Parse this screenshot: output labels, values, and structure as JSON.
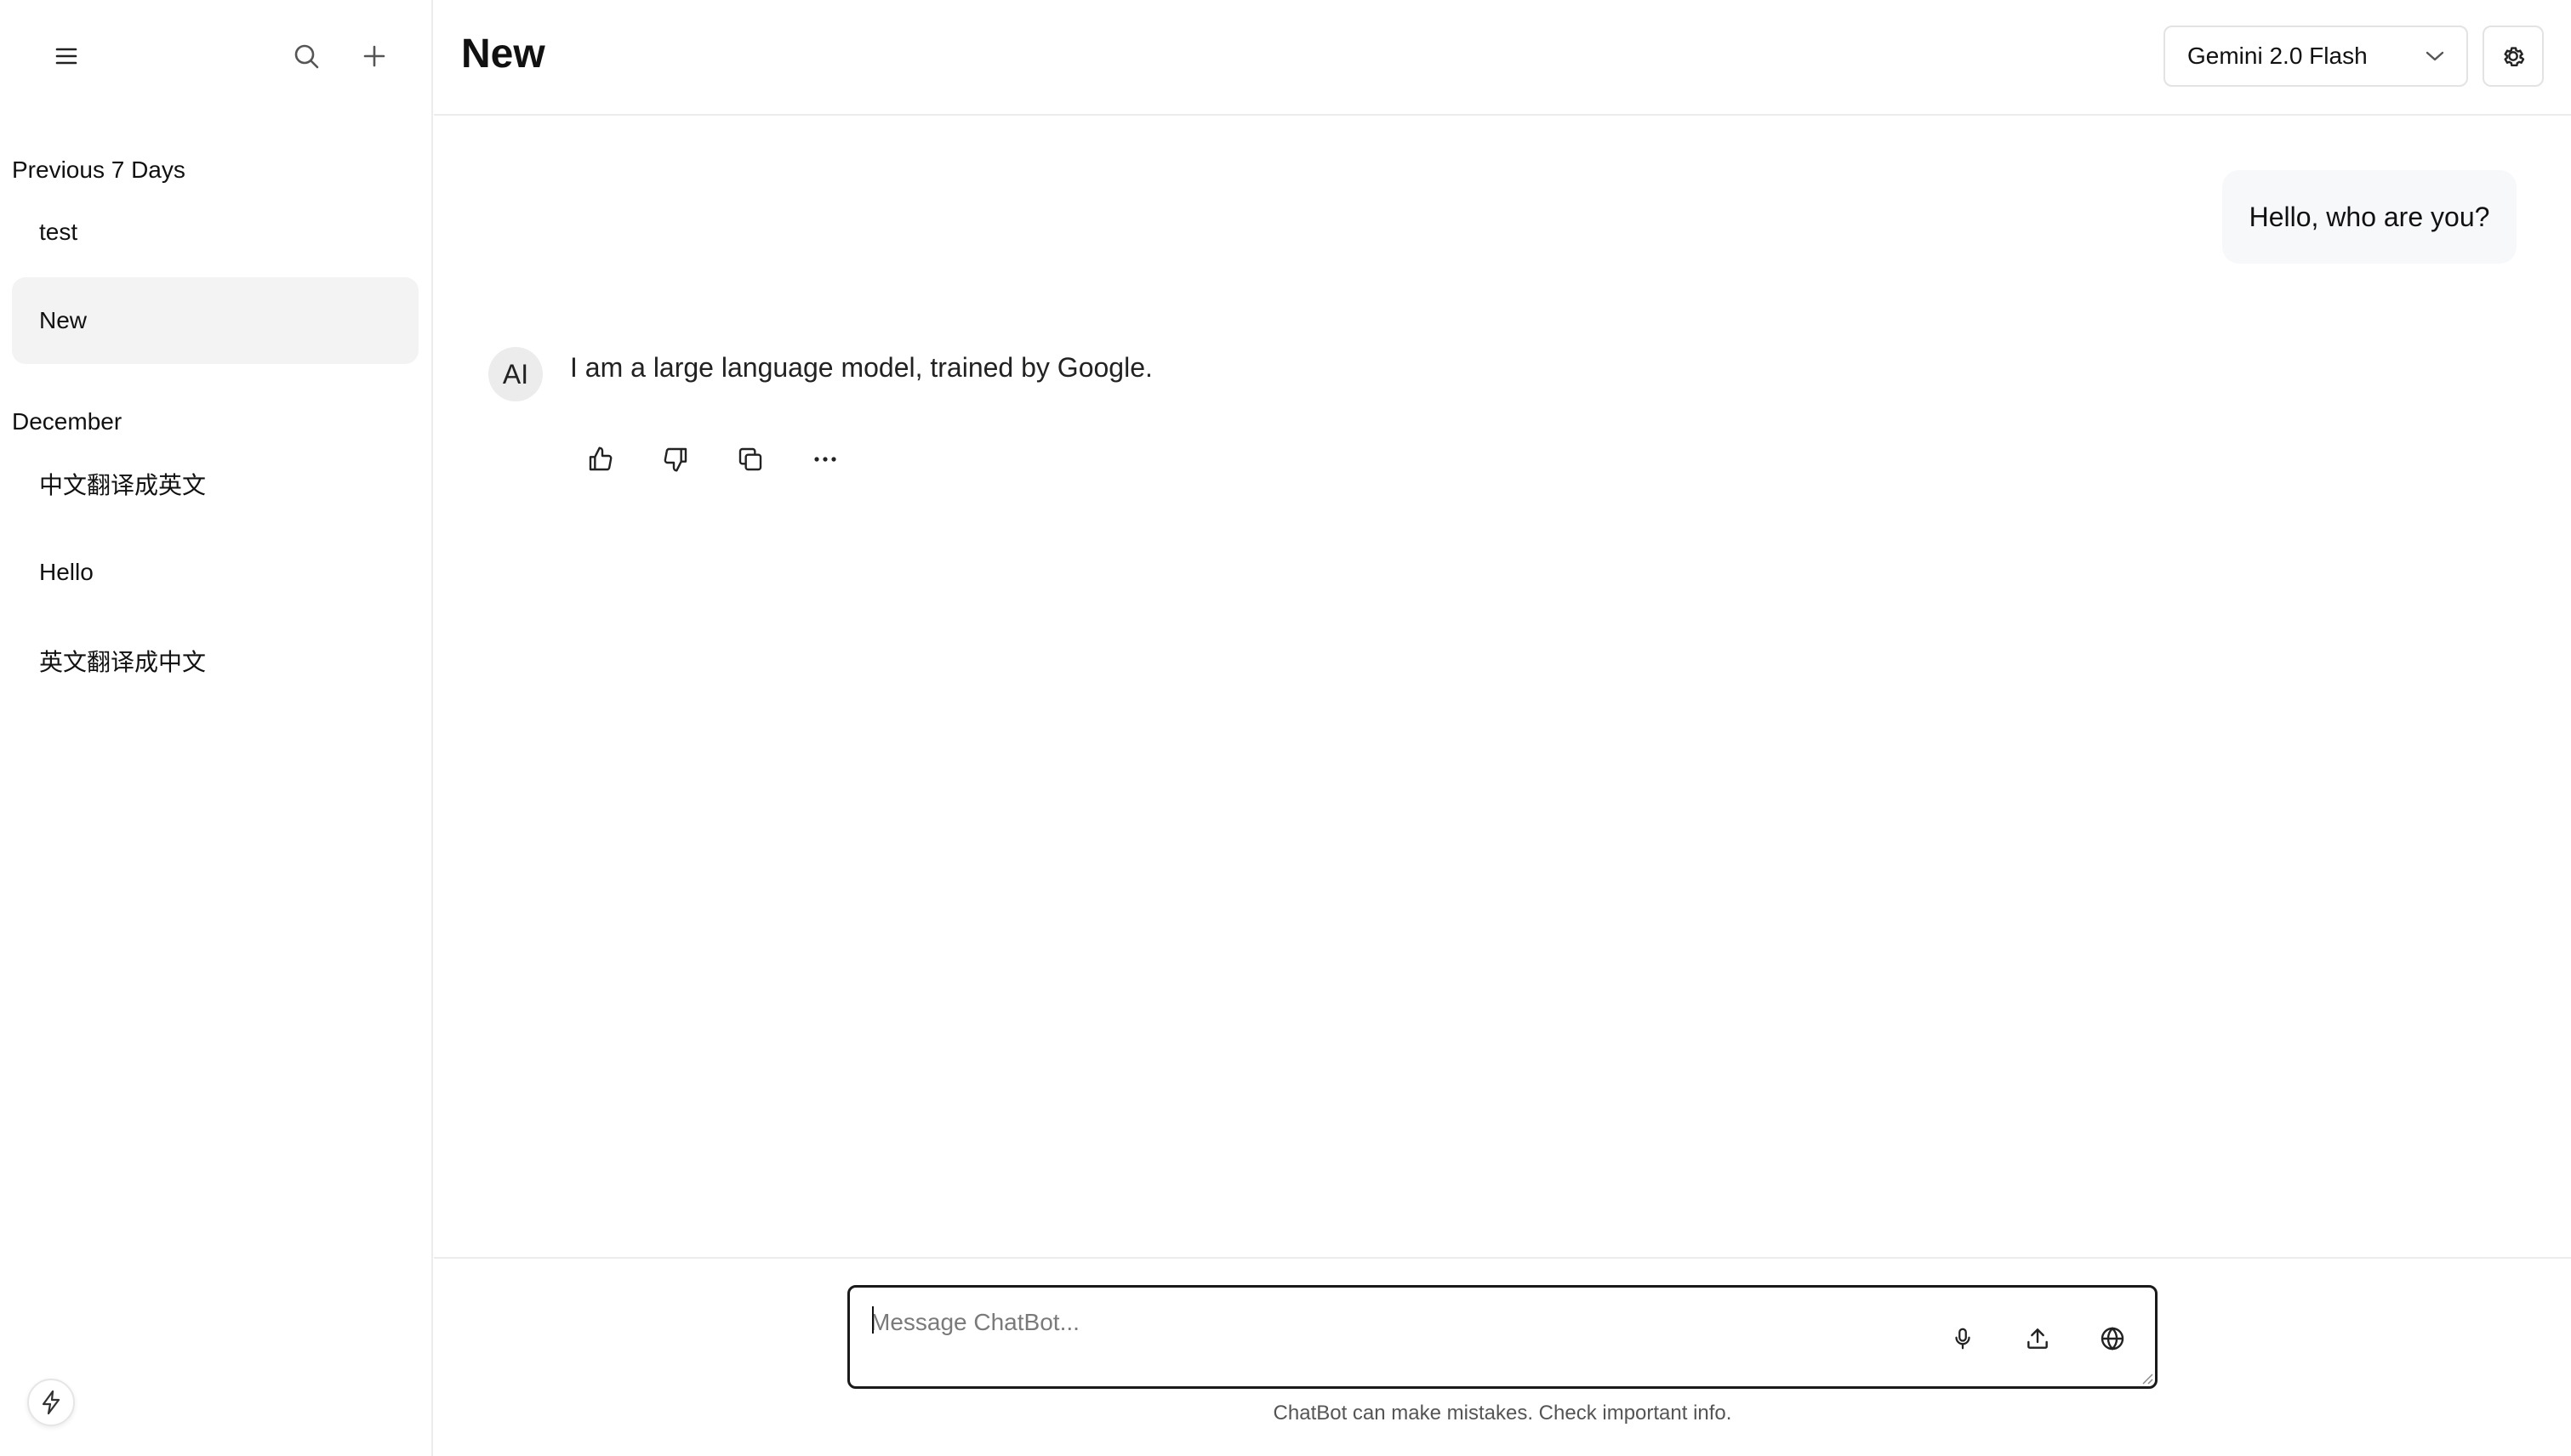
{
  "sidebar": {
    "icons": {
      "menu": "menu-icon",
      "search": "search-icon",
      "new_chat": "plus-icon",
      "bolt": "lightning-icon"
    },
    "sections": [
      {
        "title": "Previous 7 Days",
        "items": [
          {
            "label": "test"
          },
          {
            "label": "New",
            "active": true
          }
        ]
      },
      {
        "title": "December",
        "items": [
          {
            "label": "中文翻译成英文"
          },
          {
            "label": "Hello"
          },
          {
            "label": "英文翻译成中文"
          }
        ]
      }
    ]
  },
  "header": {
    "title": "New",
    "model_select": {
      "selected": "Gemini 2.0 Flash"
    },
    "settings_icon": "gear-icon"
  },
  "conversation": {
    "user_message": "Hello, who are you?",
    "ai_avatar_label": "AI",
    "ai_message": "I am a large language model, trained by Google.",
    "actions": [
      "thumbs-up-icon",
      "thumbs-down-icon",
      "copy-icon",
      "more-icon"
    ]
  },
  "composer": {
    "placeholder": "Message ChatBot...",
    "value": "",
    "buttons": [
      "microphone-icon",
      "upload-icon",
      "globe-icon"
    ],
    "disclaimer": "ChatBot can make mistakes. Check important info."
  },
  "colors": {
    "border": "#ececec",
    "active_item_bg": "#f3f3f3",
    "user_bubble_bg": "#f7f8fa",
    "avatar_bg": "#ececec",
    "composer_border": "#1a1a1a"
  }
}
